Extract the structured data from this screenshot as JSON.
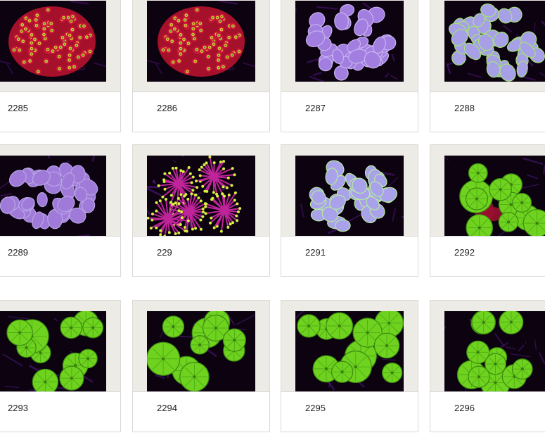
{
  "gallery": {
    "items": [
      {
        "caption": "2285",
        "coral": "red-zoanthid"
      },
      {
        "caption": "2286",
        "coral": "red-zoanthid"
      },
      {
        "caption": "2287",
        "coral": "purple-bubble"
      },
      {
        "caption": "2288",
        "coral": "lavender-bubble"
      },
      {
        "caption": "2289",
        "coral": "purple-bubble-wide"
      },
      {
        "caption": "229",
        "coral": "torch"
      },
      {
        "caption": "2291",
        "coral": "lavender-bubble-round"
      },
      {
        "caption": "2292",
        "coral": "green-mushroom"
      },
      {
        "caption": "2293",
        "coral": "green-mushroom"
      },
      {
        "caption": "2294",
        "coral": "green-mushroom"
      },
      {
        "caption": "2295",
        "coral": "green-mushroom"
      },
      {
        "caption": "2296",
        "coral": "green-mushroom"
      }
    ]
  }
}
